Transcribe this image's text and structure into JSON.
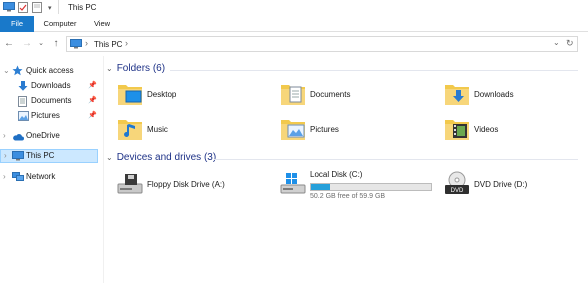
{
  "window": {
    "title": "This PC"
  },
  "ribbon": {
    "tabs": [
      "File",
      "Computer",
      "View"
    ]
  },
  "address": {
    "crumb": "This PC"
  },
  "sidebar": {
    "items": [
      {
        "label": "Quick access",
        "icon": "star-icon"
      },
      {
        "label": "Downloads",
        "icon": "download-arrow-icon"
      },
      {
        "label": "Documents",
        "icon": "documents-icon"
      },
      {
        "label": "Pictures",
        "icon": "pictures-icon"
      },
      {
        "label": "OneDrive",
        "icon": "cloud-icon"
      },
      {
        "label": "This PC",
        "icon": "computer-icon"
      },
      {
        "label": "Network",
        "icon": "network-icon"
      }
    ]
  },
  "folders": {
    "header": "Folders (6)",
    "items": [
      {
        "label": "Desktop",
        "icon": "desktop-folder-icon"
      },
      {
        "label": "Documents",
        "icon": "documents-folder-icon"
      },
      {
        "label": "Downloads",
        "icon": "downloads-folder-icon"
      },
      {
        "label": "Music",
        "icon": "music-folder-icon"
      },
      {
        "label": "Pictures",
        "icon": "pictures-folder-icon"
      },
      {
        "label": "Videos",
        "icon": "videos-folder-icon"
      }
    ]
  },
  "drives": {
    "header": "Devices and drives (3)",
    "items": [
      {
        "label": "Floppy Disk Drive (A:)",
        "icon": "floppy-drive-icon"
      },
      {
        "label": "Local Disk (C:)",
        "icon": "local-disk-icon",
        "free": "50.2 GB free of 59.9 GB",
        "used_fraction": 0.16
      },
      {
        "label": "DVD Drive (D:)",
        "icon": "dvd-drive-icon"
      }
    ]
  },
  "colors": {
    "accent": "#1979ca",
    "header_text": "#1e3287",
    "bar_fill": "#26a0da",
    "folder": "#f7d67a"
  }
}
